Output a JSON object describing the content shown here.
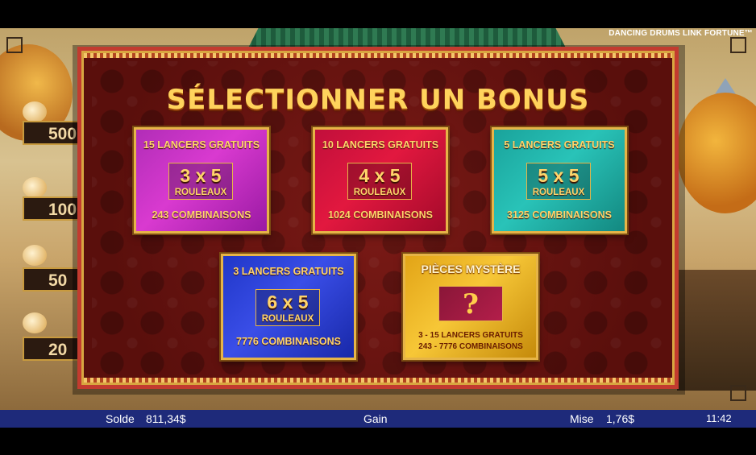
{
  "game": {
    "title": "DANCING DRUMS LINK FORTUNE™"
  },
  "side_jackpots": [
    {
      "name": "grand",
      "icon": "character-icon",
      "value": "500"
    },
    {
      "name": "major",
      "icon": "character-icon",
      "value": "100"
    },
    {
      "name": "minor",
      "icon": "character-icon",
      "value": "50"
    },
    {
      "name": "mini",
      "icon": "character-icon",
      "value": "20"
    }
  ],
  "bonus_panel": {
    "title": "SÉLECTIONNER UN BONUS",
    "options": [
      {
        "spins": "15 LANCERS GRATUITS",
        "grid": "3 x 5",
        "reels": "ROULEAUX",
        "ways": "243 COMBINAISONS",
        "color": "#c734c4"
      },
      {
        "spins": "10 LANCERS GRATUITS",
        "grid": "4 x 5",
        "reels": "ROULEAUX",
        "ways": "1024 COMBINAISONS",
        "color": "#d3143c"
      },
      {
        "spins": "5 LANCERS GRATUITS",
        "grid": "5 x 5",
        "reels": "ROULEAUX",
        "ways": "3125 COMBINAISONS",
        "color": "#22b3aa"
      },
      {
        "spins": "3 LANCERS GRATUITS",
        "grid": "6 x 5",
        "reels": "ROULEAUX",
        "ways": "7776 COMBINAISONS",
        "color": "#2f43d8"
      }
    ],
    "mystery": {
      "title": "PIÈCES MYSTÈRE",
      "symbol": "?",
      "spins_range": "3 - 15 LANCERS GRATUITS",
      "ways_range": "243 - 7776 COMBINAISONS",
      "color": "#f0b728"
    }
  },
  "status_bar": {
    "balance_label": "Solde",
    "balance_value": "811,34$",
    "win_label": "Gain",
    "bet_label": "Mise",
    "bet_value": "1,76$",
    "clock": "11:42"
  }
}
